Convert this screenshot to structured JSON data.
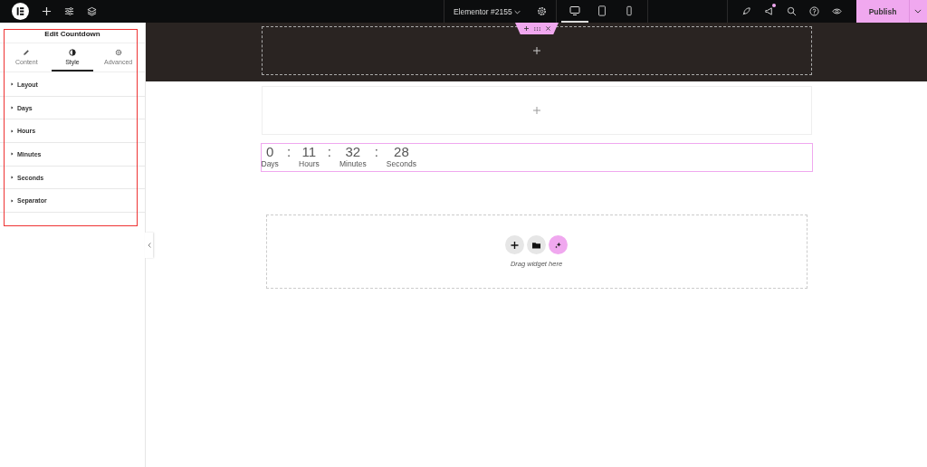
{
  "top_bar": {
    "document_title": "Elementor #2155",
    "devices": [
      {
        "kind": "desktop",
        "selected": true
      },
      {
        "kind": "tablet",
        "selected": false
      },
      {
        "kind": "mobile",
        "selected": false
      }
    ],
    "notification": true,
    "publish_label": "Publish"
  },
  "panel": {
    "title": "Edit Countdown",
    "tabs": [
      {
        "kind": "content",
        "label": "Content",
        "selected": false
      },
      {
        "kind": "style",
        "label": "Style",
        "selected": true
      },
      {
        "kind": "advanced",
        "label": "Advanced",
        "selected": false
      }
    ],
    "sections": [
      {
        "label": "Layout",
        "expanded": false
      },
      {
        "label": "Days",
        "expanded": false
      },
      {
        "label": "Hours",
        "expanded": false
      },
      {
        "label": "Minutes",
        "expanded": false
      },
      {
        "label": "Seconds",
        "expanded": false
      },
      {
        "label": "Separator",
        "expanded": false
      }
    ],
    "highlighted": true
  },
  "countdown": {
    "separator": ":",
    "units": [
      {
        "value": "0",
        "label": "Days"
      },
      {
        "value": "11",
        "label": "Hours"
      },
      {
        "value": "32",
        "label": "Minutes"
      },
      {
        "value": "28",
        "label": "Seconds"
      }
    ]
  },
  "drop_zone": {
    "hint": "Drag widget here"
  }
}
